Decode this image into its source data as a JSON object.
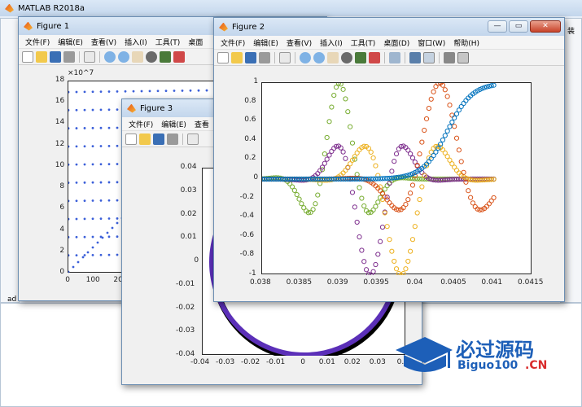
{
  "main_window": {
    "title": "MATLAB R2018a",
    "partial_label": "装",
    "partial_side": "ad"
  },
  "figure1": {
    "title": "Figure 1",
    "menu": [
      "文件(F)",
      "编辑(E)",
      "查看(V)",
      "插入(I)",
      "工具(T)",
      "桌面"
    ],
    "exponent": "×10^7",
    "y_ticks": [
      "18",
      "16",
      "14",
      "12",
      "10",
      "8",
      "6",
      "4",
      "2",
      "0"
    ],
    "x_ticks": [
      "0",
      "100",
      "20"
    ]
  },
  "figure2": {
    "title": "Figure 2",
    "menu": [
      "文件(F)",
      "编辑(E)",
      "查看(V)",
      "插入(I)",
      "工具(T)",
      "桌面(D)",
      "窗口(W)",
      "帮助(H)"
    ],
    "y_ticks": [
      "1",
      "0.8",
      "0.6",
      "0.4",
      "0.2",
      "0",
      "-0.2",
      "-0.4",
      "-0.6",
      "-0.8",
      "-1"
    ],
    "x_ticks": [
      "0.038",
      "0.0385",
      "0.039",
      "0.0395",
      "0.04",
      "0.0405",
      "0.041",
      "0.0415"
    ]
  },
  "figure3": {
    "title": "Figure 3",
    "menu": [
      "文件(F)",
      "编辑(E)",
      "查看"
    ],
    "y_ticks": [
      "0.04",
      "0.03",
      "0.02",
      "0.01",
      "0",
      "-0.01",
      "-0.02",
      "-0.03",
      "-0.04"
    ],
    "x_ticks": [
      "-0.04",
      "-0.03",
      "-0.02",
      "-0.01",
      "0",
      "0.01",
      "0.02",
      "0.03",
      "0.0"
    ]
  },
  "watermark": {
    "cn": "必过源码",
    "en": "Biguo100",
    "suffix": ".CN"
  },
  "chart_data": [
    {
      "type": "scatter",
      "panel": "Figure 2",
      "xlim": [
        0.038,
        0.0415
      ],
      "ylim": [
        -1,
        1
      ],
      "series": [
        {
          "color": "#0072bd",
          "description": "sigmoid rising to 1"
        },
        {
          "color": "#d95319",
          "description": "oscillation peak ~1 at 0.0403"
        },
        {
          "color": "#edb120",
          "description": "oscillation min ~-1 at 0.0398"
        },
        {
          "color": "#7e2f8e",
          "description": "oscillation min ~-1 at 0.0394"
        },
        {
          "color": "#77ac30",
          "description": "oscillation peak 1 at 0.039"
        }
      ]
    },
    {
      "type": "scatter",
      "panel": "Figure 3",
      "xlim": [
        -0.04,
        0.04
      ],
      "ylim": [
        -0.04,
        0.04
      ],
      "description": "circle of radius ~0.04"
    }
  ],
  "colors": {
    "titlebar": "#c3d6ec",
    "close": "#c8432a",
    "blue": "#0072bd",
    "orange": "#d95319",
    "yellow": "#edb120",
    "purple": "#7e2f8e",
    "green": "#77ac30"
  }
}
